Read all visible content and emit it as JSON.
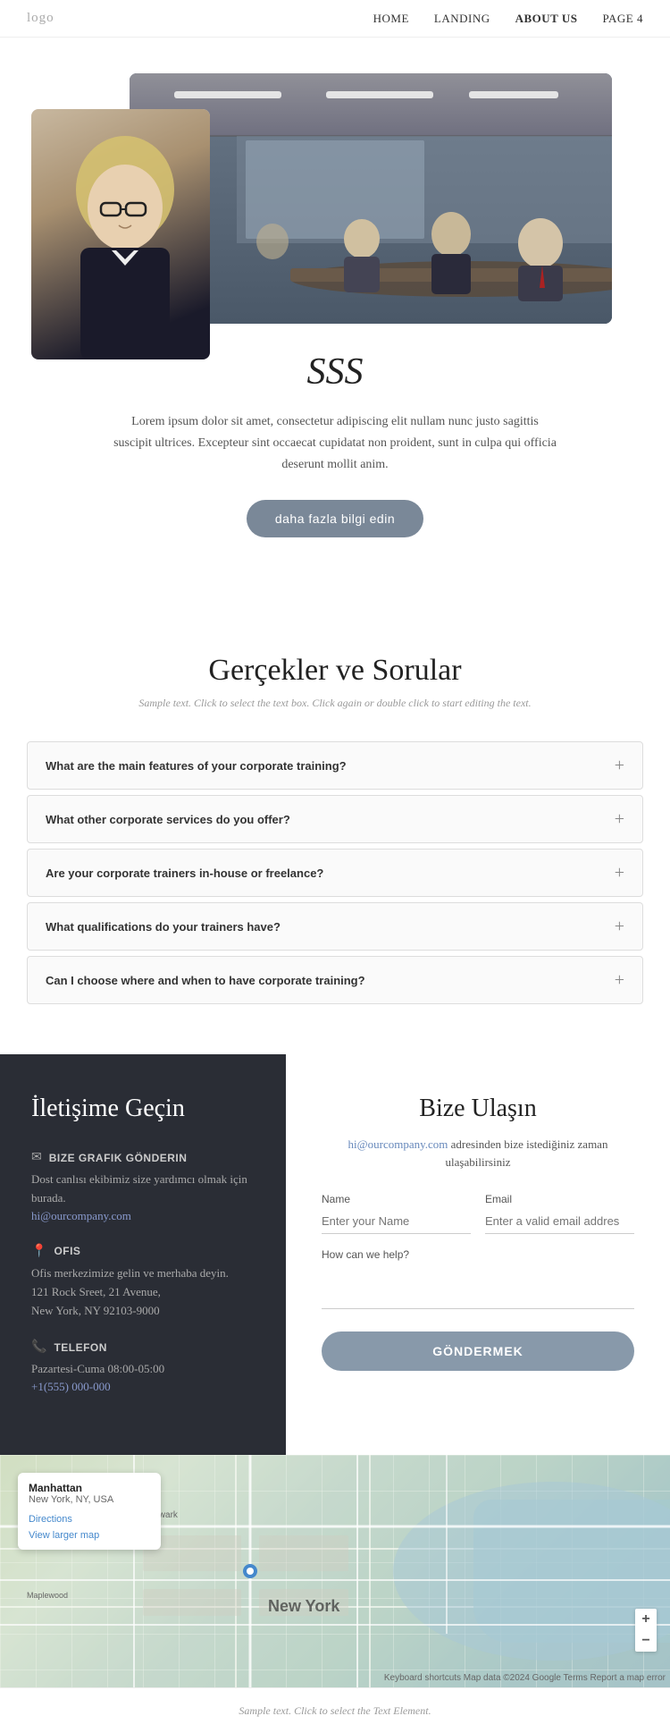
{
  "nav": {
    "logo": "logo",
    "links": [
      {
        "id": "home",
        "label": "HOME"
      },
      {
        "id": "landing",
        "label": "LANDING"
      },
      {
        "id": "about",
        "label": "ABOUT US",
        "active": true
      },
      {
        "id": "page4",
        "label": "PAGE 4"
      }
    ]
  },
  "hero": {
    "title": "SSS",
    "description": "Lorem ipsum dolor sit amet, consectetur adipiscing elit nullam nunc justo sagittis suscipit ultrices. Excepteur sint occaecat cupidatat non proident, sunt in culpa qui officia deserunt mollit anim.",
    "button_label": "daha fazla bilgi edin"
  },
  "faq": {
    "title": "Gerçekler ve Sorular",
    "subtitle": "Sample text. Click to select the text box. Click again or double click to start editing the text.",
    "items": [
      {
        "id": "q1",
        "question": "What are the main features of your corporate training?"
      },
      {
        "id": "q2",
        "question": "What other corporate services do you offer?"
      },
      {
        "id": "q3",
        "question": "Are your corporate trainers in-house or freelance?"
      },
      {
        "id": "q4",
        "question": "What qualifications do your trainers have?"
      },
      {
        "id": "q5",
        "question": "Can I choose where and when to have corporate training?"
      }
    ],
    "plus_symbol": "+"
  },
  "contact": {
    "left": {
      "title": "İletişime Geçin",
      "items": [
        {
          "id": "email-item",
          "icon": "✉",
          "title": "BIZE GRAFIK GÖNDERIN",
          "text": "Dost canlısı ekibimiz size yardımcı olmak için burada.",
          "link": "hi@ourcompany.com"
        },
        {
          "id": "office-item",
          "icon": "📍",
          "title": "OFIS",
          "text": "Ofis merkezimize gelin ve merhaba deyin.\n121 Rock Sreet, 21 Avenue,\nNew York, NY 92103-9000",
          "link": null
        },
        {
          "id": "phone-item",
          "icon": "📞",
          "title": "TELEFON",
          "text": "Pazartesi-Cuma 08:00-05:00",
          "link": "+1(555) 000-000"
        }
      ]
    },
    "right": {
      "title": "Bize Ulaşın",
      "description_before": "",
      "email_link": "hi@ourcompany.com",
      "description_after": " adresinden bize istediğiniz zaman ulaşabilirsiniz",
      "name_label": "Name",
      "name_placeholder": "Enter your Name",
      "email_label": "Email",
      "email_placeholder": "Enter a valid email addres",
      "help_label": "How can we help?",
      "submit_label": "GÖNDERMEK"
    }
  },
  "map": {
    "location": "Manhattan",
    "address": "New York, NY, USA",
    "directions_label": "Directions",
    "view_larger_label": "View larger map",
    "attribution": "Keyboard shortcuts  Map data ©2024 Google  Terms  Report a map error",
    "zoom_in": "+",
    "zoom_out": "−",
    "ny_label": "New York"
  },
  "footer": {
    "text": "Sample text. Click to select the Text Element."
  }
}
